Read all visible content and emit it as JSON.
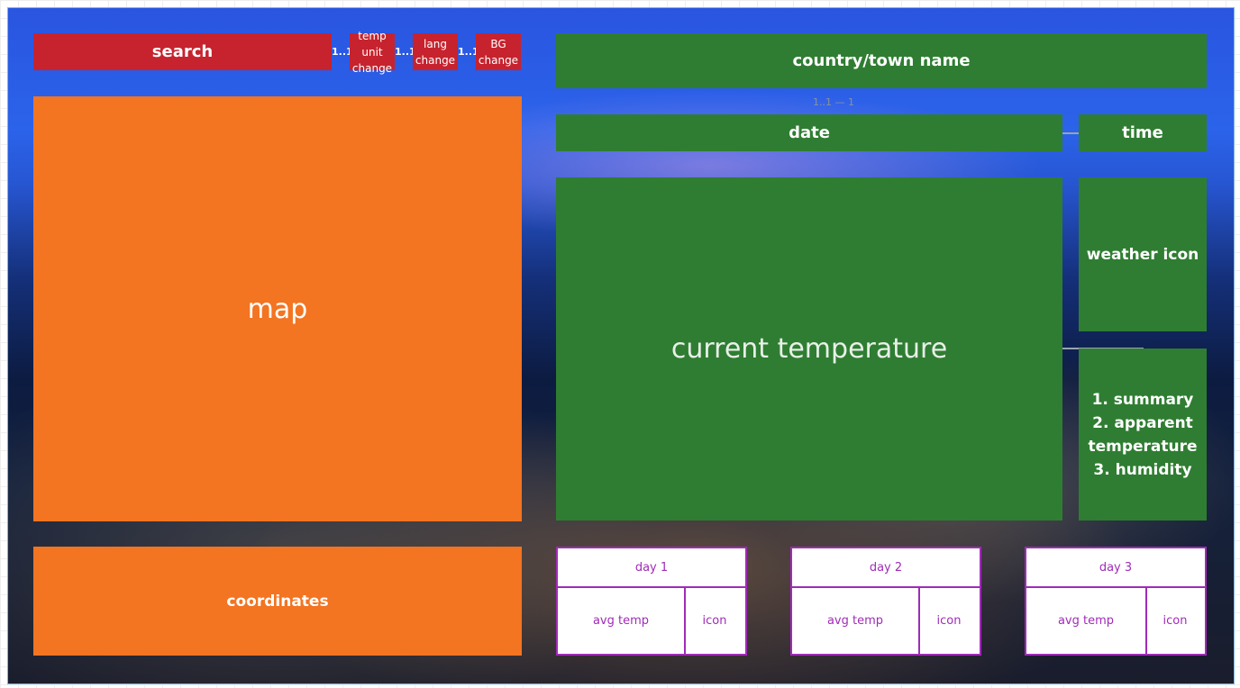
{
  "left": {
    "search": "search",
    "temp_unit_change": "temp unit change",
    "lang_change": "lang change",
    "bg_change": "BG change",
    "multiplicity": "1..1",
    "map": "map",
    "coordinates": "coordinates"
  },
  "right": {
    "location": "country/town name",
    "date": "date",
    "time": "time",
    "current_temperature": "current temperature",
    "weather_icon": "weather icon",
    "details": [
      "1. summary",
      "2. apparent temperature",
      "3. humidity"
    ],
    "connector_label": "1..1 — 1"
  },
  "forecast": [
    {
      "day": "day 1",
      "avg": "avg temp",
      "icon": "icon"
    },
    {
      "day": "day 2",
      "avg": "avg temp",
      "icon": "icon"
    },
    {
      "day": "day 3",
      "avg": "avg temp",
      "icon": "icon"
    }
  ],
  "colors": {
    "control": "#c6232e",
    "map_panel": "#f37421",
    "weather_panel": "#2f7d32",
    "forecast_border": "#a02bb8"
  }
}
